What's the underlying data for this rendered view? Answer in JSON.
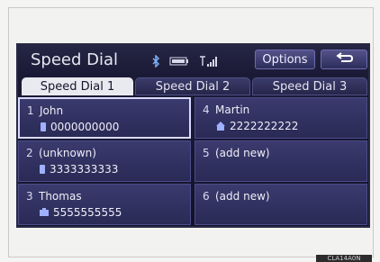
{
  "header": {
    "title": "Speed Dial",
    "options_label": "Options",
    "status_icons": [
      "bluetooth-icon",
      "battery-icon",
      "signal-icon"
    ]
  },
  "tabs": [
    {
      "label": "Speed Dial 1",
      "active": true
    },
    {
      "label": "Speed Dial 2",
      "active": false
    },
    {
      "label": "Speed Dial 3",
      "active": false
    }
  ],
  "entries": [
    {
      "num": "1",
      "name": "John",
      "phone": "0000000000",
      "type_icon": "mobile-icon"
    },
    {
      "num": "2",
      "name": "(unknown)",
      "phone": "3333333333",
      "type_icon": "mobile-icon"
    },
    {
      "num": "3",
      "name": "Thomas",
      "phone": "5555555555",
      "type_icon": "work-icon"
    },
    {
      "num": "4",
      "name": "Martin",
      "phone": "2222222222",
      "type_icon": "home-icon"
    },
    {
      "num": "5",
      "name": "(add new)",
      "phone": "",
      "type_icon": ""
    },
    {
      "num": "6",
      "name": "(add new)",
      "phone": "",
      "type_icon": ""
    }
  ],
  "footer_tag": "CLA14A0N",
  "colors": {
    "screen_bg": "#171733",
    "cell_bg": "#33336a",
    "selected_border": "#d9d9ff",
    "accent": "#6c6cb0"
  }
}
